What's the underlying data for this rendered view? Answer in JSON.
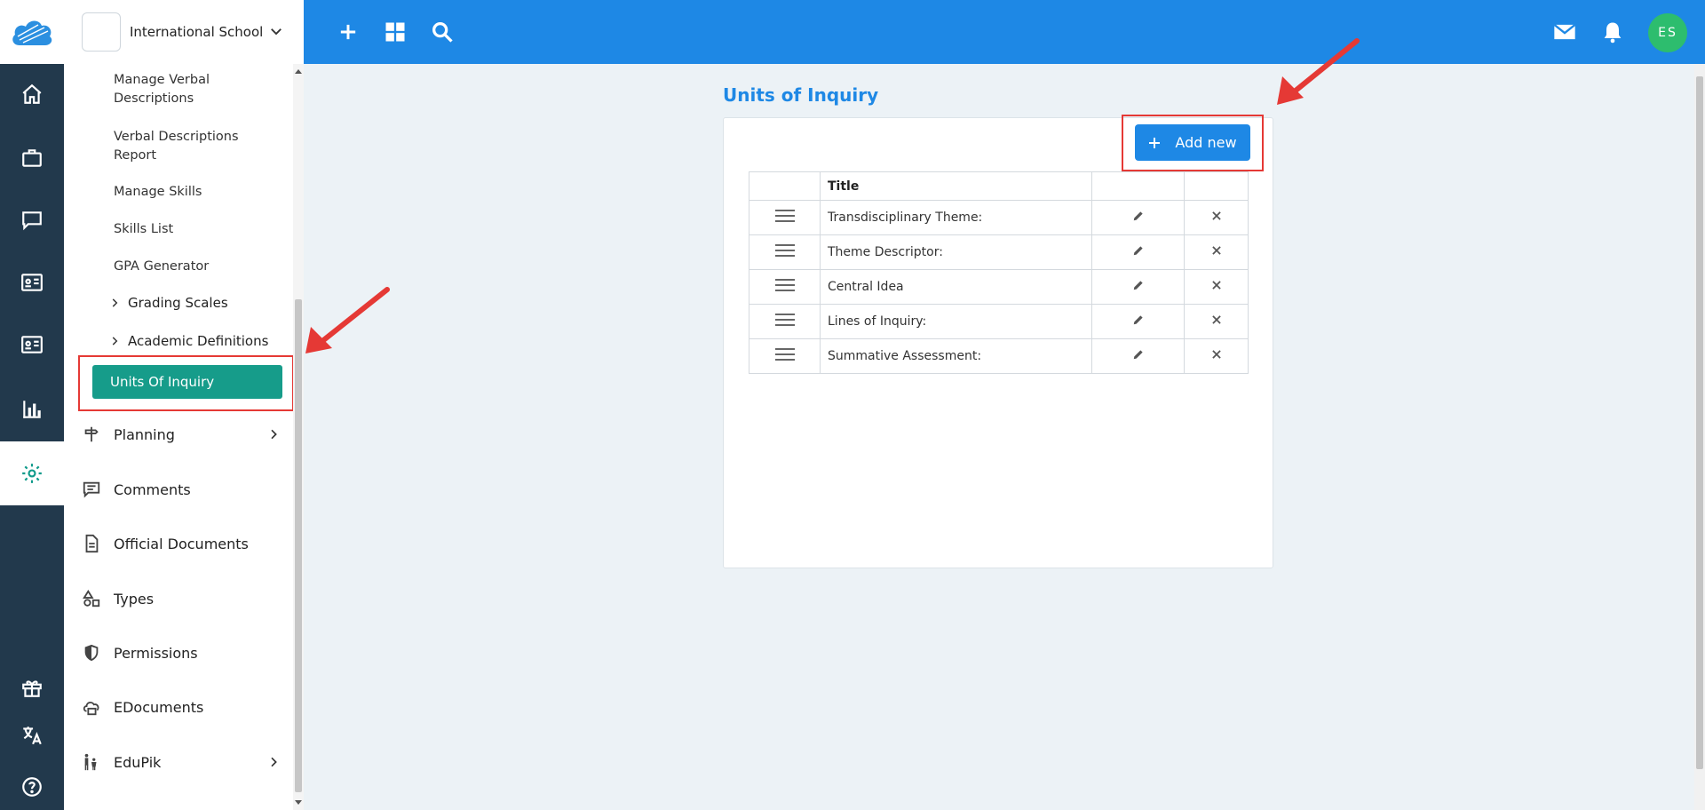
{
  "school": {
    "name": "International School"
  },
  "sidebar": {
    "sub_items": [
      {
        "label": "Manage Verbal Descriptions"
      },
      {
        "label": "Verbal Descriptions Report"
      },
      {
        "label": "Manage Skills"
      },
      {
        "label": "Skills List"
      },
      {
        "label": "GPA Generator"
      }
    ],
    "groups": [
      {
        "label": "Grading Scales"
      },
      {
        "label": "Academic Definitions"
      }
    ],
    "active_item": {
      "label": "Units Of Inquiry"
    },
    "main_items": [
      {
        "label": "Planning",
        "icon": "signpost-icon"
      },
      {
        "label": "Comments",
        "icon": "comment-icon"
      },
      {
        "label": "Official Documents",
        "icon": "document-icon"
      },
      {
        "label": "Types",
        "icon": "shapes-icon"
      },
      {
        "label": "Permissions",
        "icon": "shield-icon"
      },
      {
        "label": "EDocuments",
        "icon": "cloud-print-icon"
      },
      {
        "label": "EduPik",
        "icon": "family-icon"
      }
    ]
  },
  "topbar": {
    "avatar_initials": "ES"
  },
  "main": {
    "title": "Units of Inquiry",
    "add_button": "Add new",
    "table": {
      "header": "Title",
      "rows": [
        {
          "title": "Transdisciplinary Theme:"
        },
        {
          "title": "Theme Descriptor:"
        },
        {
          "title": "Central Idea"
        },
        {
          "title": "Lines of Inquiry:"
        },
        {
          "title": "Summative Assessment:"
        }
      ]
    }
  },
  "colors": {
    "primary": "#1e88e5",
    "active_teal": "#169c8a",
    "rail": "#22394c",
    "highlight_red": "#e53935"
  }
}
